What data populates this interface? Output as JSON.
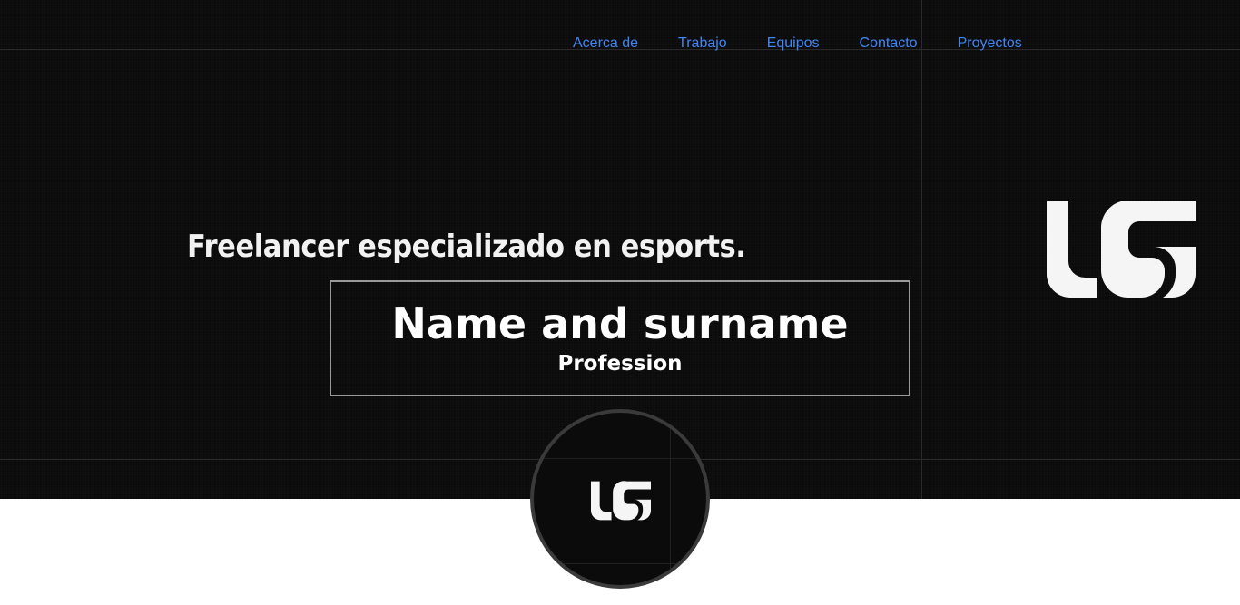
{
  "nav": {
    "items": [
      {
        "label": "Acerca de"
      },
      {
        "label": "Trabajo"
      },
      {
        "label": "Equipos"
      },
      {
        "label": "Contacto"
      },
      {
        "label": "Proyectos"
      }
    ]
  },
  "hero": {
    "tagline": "Freelancer especializado en esports.",
    "name": "Name and surname",
    "profession": "Profession"
  },
  "logo": {
    "icon": "lg-monogram-logo",
    "letters": "LG"
  },
  "colors": {
    "hero_background": "#0b0b0b",
    "nav_link": "#3f86f5",
    "page_background": "#ffffff",
    "text": "#ffffff"
  }
}
